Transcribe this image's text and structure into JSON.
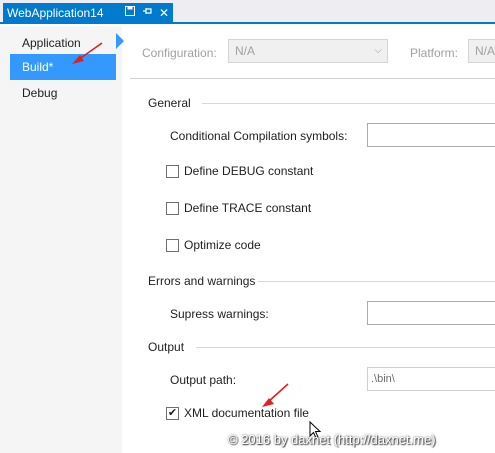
{
  "tab": {
    "title": "WebApplication14",
    "save_icon": "save-icon",
    "pin_icon": "pin-icon",
    "close_icon": "close-icon"
  },
  "nav": {
    "items": [
      {
        "label": "Application",
        "selected": false
      },
      {
        "label": "Build*",
        "selected": true
      },
      {
        "label": "Debug",
        "selected": false
      }
    ]
  },
  "header": {
    "configuration_label": "Configuration:",
    "configuration_value": "N/A",
    "platform_label": "Platform:",
    "platform_value": "N/A"
  },
  "general": {
    "title": "General",
    "cond_symbols_label": "Conditional Compilation symbols:",
    "cond_symbols_value": "",
    "debug_label": "Define DEBUG constant",
    "debug_checked": false,
    "trace_label": "Define TRACE constant",
    "trace_checked": false,
    "optimize_label": "Optimize code",
    "optimize_checked": false
  },
  "errors": {
    "title": "Errors and warnings",
    "suppress_label": "Supress warnings:",
    "suppress_value": ""
  },
  "output": {
    "title": "Output",
    "path_label": "Output path:",
    "path_value": ".\\bin\\",
    "xml_label": "XML documentation file",
    "xml_checked": true,
    "xml_check_glyph": "✔"
  },
  "watermark": "© 2016 by daxnet (http://daxnet.me)",
  "colors": {
    "accent": "#007acc",
    "selected_nav": "#3399ff",
    "annotation": "#e02020"
  }
}
